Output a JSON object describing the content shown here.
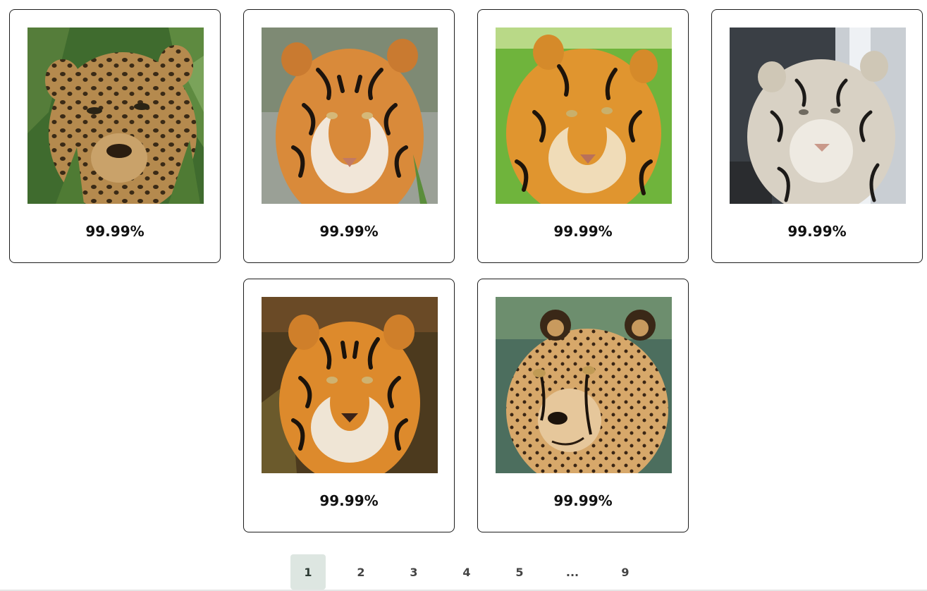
{
  "results": [
    {
      "animal": "leopard",
      "score": "99.99%"
    },
    {
      "animal": "tiger",
      "score": "99.99%"
    },
    {
      "animal": "tiger",
      "score": "99.99%"
    },
    {
      "animal": "white tiger",
      "score": "99.99%"
    },
    {
      "animal": "tiger",
      "score": "99.99%"
    },
    {
      "animal": "cheetah",
      "score": "99.99%"
    }
  ],
  "pagination": {
    "pages": [
      "1",
      "2",
      "3",
      "4",
      "5",
      "...",
      "9"
    ],
    "current": "1"
  },
  "colors": {
    "active_page_bg": "#dde6e1",
    "card_border": "#1c1c1c"
  }
}
